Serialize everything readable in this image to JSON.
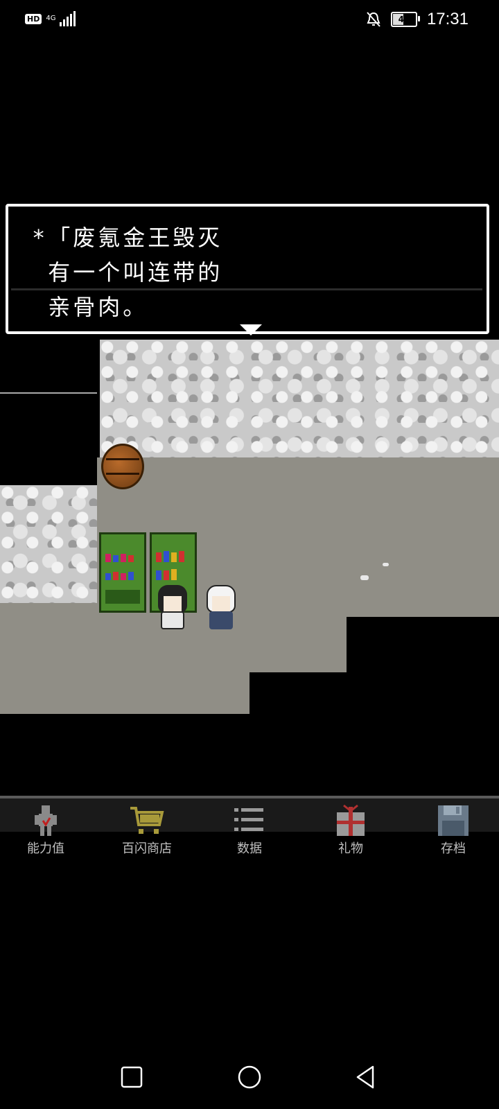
{
  "status_bar": {
    "hd": "HD",
    "network": "4G",
    "battery": "49",
    "battery_level": 0.49,
    "time": "17:31",
    "icons": [
      "signal-icon",
      "mute-icon",
      "battery-icon"
    ]
  },
  "dialog": {
    "lines": [
      "*「废氪金王毁灭",
      " 有一个叫连带的",
      " 亲骨肉。"
    ]
  },
  "scene": {
    "objects": [
      "barrel",
      "item-shelf",
      "potion-shelf",
      "dark-haired-character",
      "white-haired-character",
      "pebbles"
    ]
  },
  "menu": {
    "items": [
      {
        "label": "能力值",
        "icon": "character-icon"
      },
      {
        "label": "百闪商店",
        "icon": "cart-icon"
      },
      {
        "label": "数据",
        "icon": "list-icon"
      },
      {
        "label": "礼物",
        "icon": "gift-icon"
      },
      {
        "label": "存档",
        "icon": "save-icon"
      }
    ]
  },
  "navbar": {
    "icons": [
      "recent-apps-icon",
      "home-icon",
      "back-icon"
    ]
  },
  "colors": {
    "background": "#000000",
    "rock": "#c9c9c9",
    "floor": "#908e86",
    "shelf": "#4b8a2c",
    "cart": "#a89a3a",
    "gift": "#b03030",
    "save": "#6a7a8a"
  }
}
